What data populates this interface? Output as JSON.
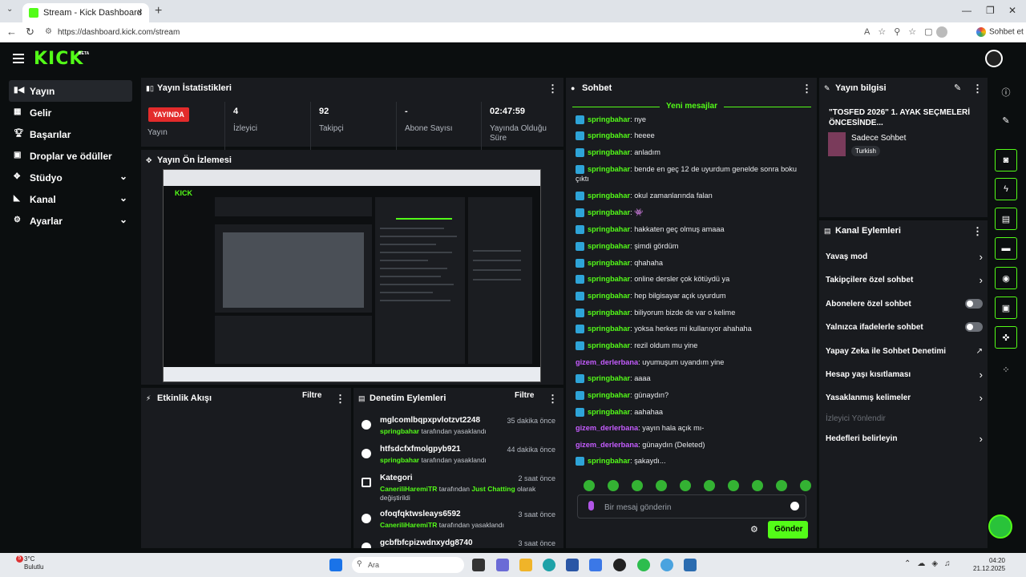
{
  "browser": {
    "tab_title": "Stream - Kick Dashboard",
    "url": "https://dashboard.kick.com/stream",
    "chat_with": "Sohbet et"
  },
  "brand": {
    "logo": "KICK",
    "beta": "BETA"
  },
  "colors": {
    "accent": "#53fc18",
    "live": "#e32b2b",
    "panel": "#191b1f",
    "bg": "#0b0e0f"
  },
  "sidebar": {
    "items": [
      {
        "label": "Yayın",
        "icon": "broadcast-icon",
        "active": true
      },
      {
        "label": "Gelir",
        "icon": "revenue-icon"
      },
      {
        "label": "Başarılar",
        "icon": "trophy-icon"
      },
      {
        "label": "Droplar ve ödüller",
        "icon": "gift-icon"
      },
      {
        "label": "Stüdyo",
        "icon": "studio-icon"
      },
      {
        "label": "Kanal",
        "icon": "channel-icon"
      },
      {
        "label": "Ayarlar",
        "icon": "gear-icon"
      }
    ]
  },
  "stats": {
    "title": "Yayın İstatistikleri",
    "live_badge": "YAYINDA",
    "live_label": "Yayın",
    "viewers": {
      "value": "4",
      "label": "İzleyici"
    },
    "followers": {
      "value": "92",
      "label": "Takipçi"
    },
    "subs": {
      "value": "-",
      "label": "Abone Sayısı"
    },
    "uptime": {
      "value": "02:47:59",
      "label": "Yayında Olduğu Süre"
    }
  },
  "preview": {
    "title": "Yayın Ön İzlemesi"
  },
  "activity": {
    "title": "Etkinlik Akışı",
    "filter": "Filtre"
  },
  "moderation": {
    "title": "Denetim Eylemleri",
    "filter": "Filtre",
    "rows": [
      {
        "name": "mglcomlbqpxpvlotzvt2248",
        "time": "35 dakika önce",
        "user": "springbahar",
        "text": "tarafından yasaklandı"
      },
      {
        "name": "htfsdcfxfmolgpyb921",
        "time": "44 dakika önce",
        "user": "springbahar",
        "text": "tarafından yasaklandı"
      },
      {
        "name": "Kategori",
        "time": "2 saat önce",
        "user": "CaneriliHaremiTR",
        "text": "tarafından",
        "cat": "Just Chatting",
        "text2": "olarak değiştirildi"
      },
      {
        "name": "ofoqfqktwsleays6592",
        "time": "3 saat önce",
        "user": "CaneriliHaremiTR",
        "text": "tarafından yasaklandı"
      },
      {
        "name": "gcbfbfcpizwdnxydg8740",
        "time": "3 saat önce",
        "user": "",
        "text": ""
      }
    ]
  },
  "chat": {
    "title": "Sohbet",
    "new_messages": "Yeni mesajlar",
    "messages": [
      {
        "user": "springbahar",
        "text": ": nye",
        "badge": true
      },
      {
        "user": "springbahar",
        "text": ": heeee",
        "badge": true
      },
      {
        "user": "springbahar",
        "text": ": anladım",
        "badge": true
      },
      {
        "user": "springbahar",
        "text": ": bende en geç 12 de uyurdum genelde sonra boku çıktı",
        "badge": true
      },
      {
        "user": "springbahar",
        "text": ": okul zamanlarında falan",
        "badge": true
      },
      {
        "user": "springbahar",
        "text": ": 👾",
        "badge": true
      },
      {
        "user": "springbahar",
        "text": ": hakkaten geç olmuş amaaa",
        "badge": true
      },
      {
        "user": "springbahar",
        "text": ": şimdi gördüm",
        "badge": true
      },
      {
        "user": "springbahar",
        "text": ": qhahaha",
        "badge": true
      },
      {
        "user": "springbahar",
        "text": ": online dersler çok kötüydü ya",
        "badge": true
      },
      {
        "user": "springbahar",
        "text": ": hep bilgisayar açık uyurdum",
        "badge": true
      },
      {
        "user": "springbahar",
        "text": ": biliyorum bizde de var o kelime",
        "badge": true
      },
      {
        "user": "springbahar",
        "text": ": yoksa herkes mi kullanıyor ahahaha",
        "badge": true
      },
      {
        "user": "springbahar",
        "text": ": rezil oldum mu yine",
        "badge": true
      },
      {
        "user": "gizem_derlerbana",
        "text": ": uyumuşum uyandım yine",
        "badge": false
      },
      {
        "user": "springbahar",
        "text": ": aaaa",
        "badge": true
      },
      {
        "user": "springbahar",
        "text": ": günaydın?",
        "badge": true
      },
      {
        "user": "springbahar",
        "text": ": aahahaa",
        "badge": true
      },
      {
        "user": "gizem_derlerbana",
        "text": ": yayın hala açık mı-",
        "badge": false
      },
      {
        "user": "gizem_derlerbana",
        "text": ": günaydın (Deleted)",
        "badge": false
      },
      {
        "user": "springbahar",
        "text": ": şakaydı...",
        "badge": true
      }
    ],
    "input_placeholder": "Bir mesaj gönderin",
    "send": "Gönder"
  },
  "stream_info": {
    "title": "Yayın bilgisi",
    "stream_title": "\"TOSFED 2026\" 1. AYAK SEÇMELERİ ÖNCESİNDE...",
    "category": "Sadece Sohbet",
    "language": "Turkish"
  },
  "channel_actions": {
    "title": "Kanal Eylemleri",
    "items": [
      {
        "label": "Yavaş mod",
        "kind": "arrow"
      },
      {
        "label": "Takipçilere özel sohbet",
        "kind": "arrow"
      },
      {
        "label": "Abonelere özel sohbet",
        "kind": "toggle"
      },
      {
        "label": "Yalnızca ifadelerle sohbet",
        "kind": "toggle"
      },
      {
        "label": "Yapay Zeka ile Sohbet Denetimi",
        "kind": "external"
      },
      {
        "label": "Hesap yaşı kısıtlaması",
        "kind": "arrow"
      },
      {
        "label": "Yasaklanmış kelimeler",
        "kind": "arrow"
      },
      {
        "label": "İzleyici Yönlendir",
        "kind": "disabled"
      },
      {
        "label": "Hedefleri belirleyin",
        "kind": "arrow"
      }
    ]
  },
  "taskbar": {
    "weather_temp": "3°C",
    "weather_text": "Bulutlu",
    "notif_count": "5",
    "search": "Ara",
    "time": "04:20",
    "date": "21.12.2025"
  }
}
